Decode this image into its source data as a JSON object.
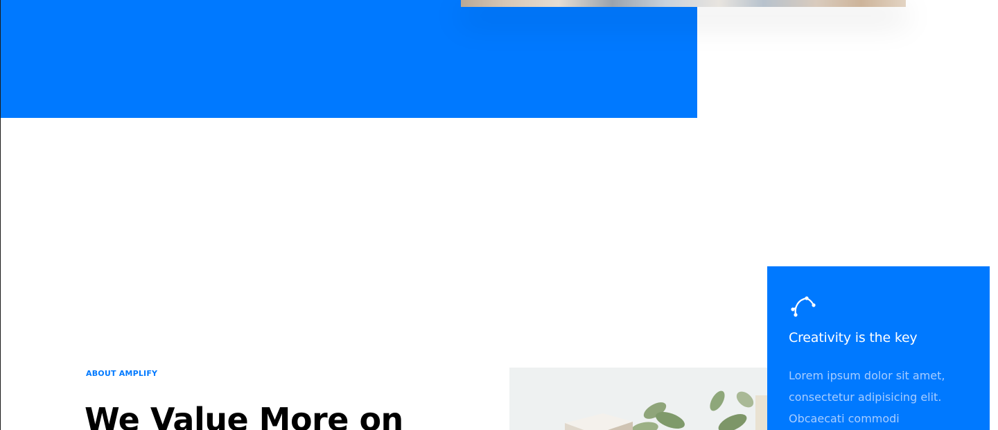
{
  "hero": {
    "photo_alt": "team photo"
  },
  "feature_card": {
    "icon": "vector-curve-icon",
    "title": "Creativity is the key",
    "text": "Lorem ipsum dolor sit amet, consectetur adipisicing elit. Obcaecati commodi"
  },
  "about": {
    "eyebrow": "ABOUT AMPLIFY",
    "heading": "We Value More on",
    "image_alt": "plant and boxes photo"
  },
  "colors": {
    "accent": "#0079ff",
    "card_text": "#a8cdff",
    "heading": "#000000"
  }
}
